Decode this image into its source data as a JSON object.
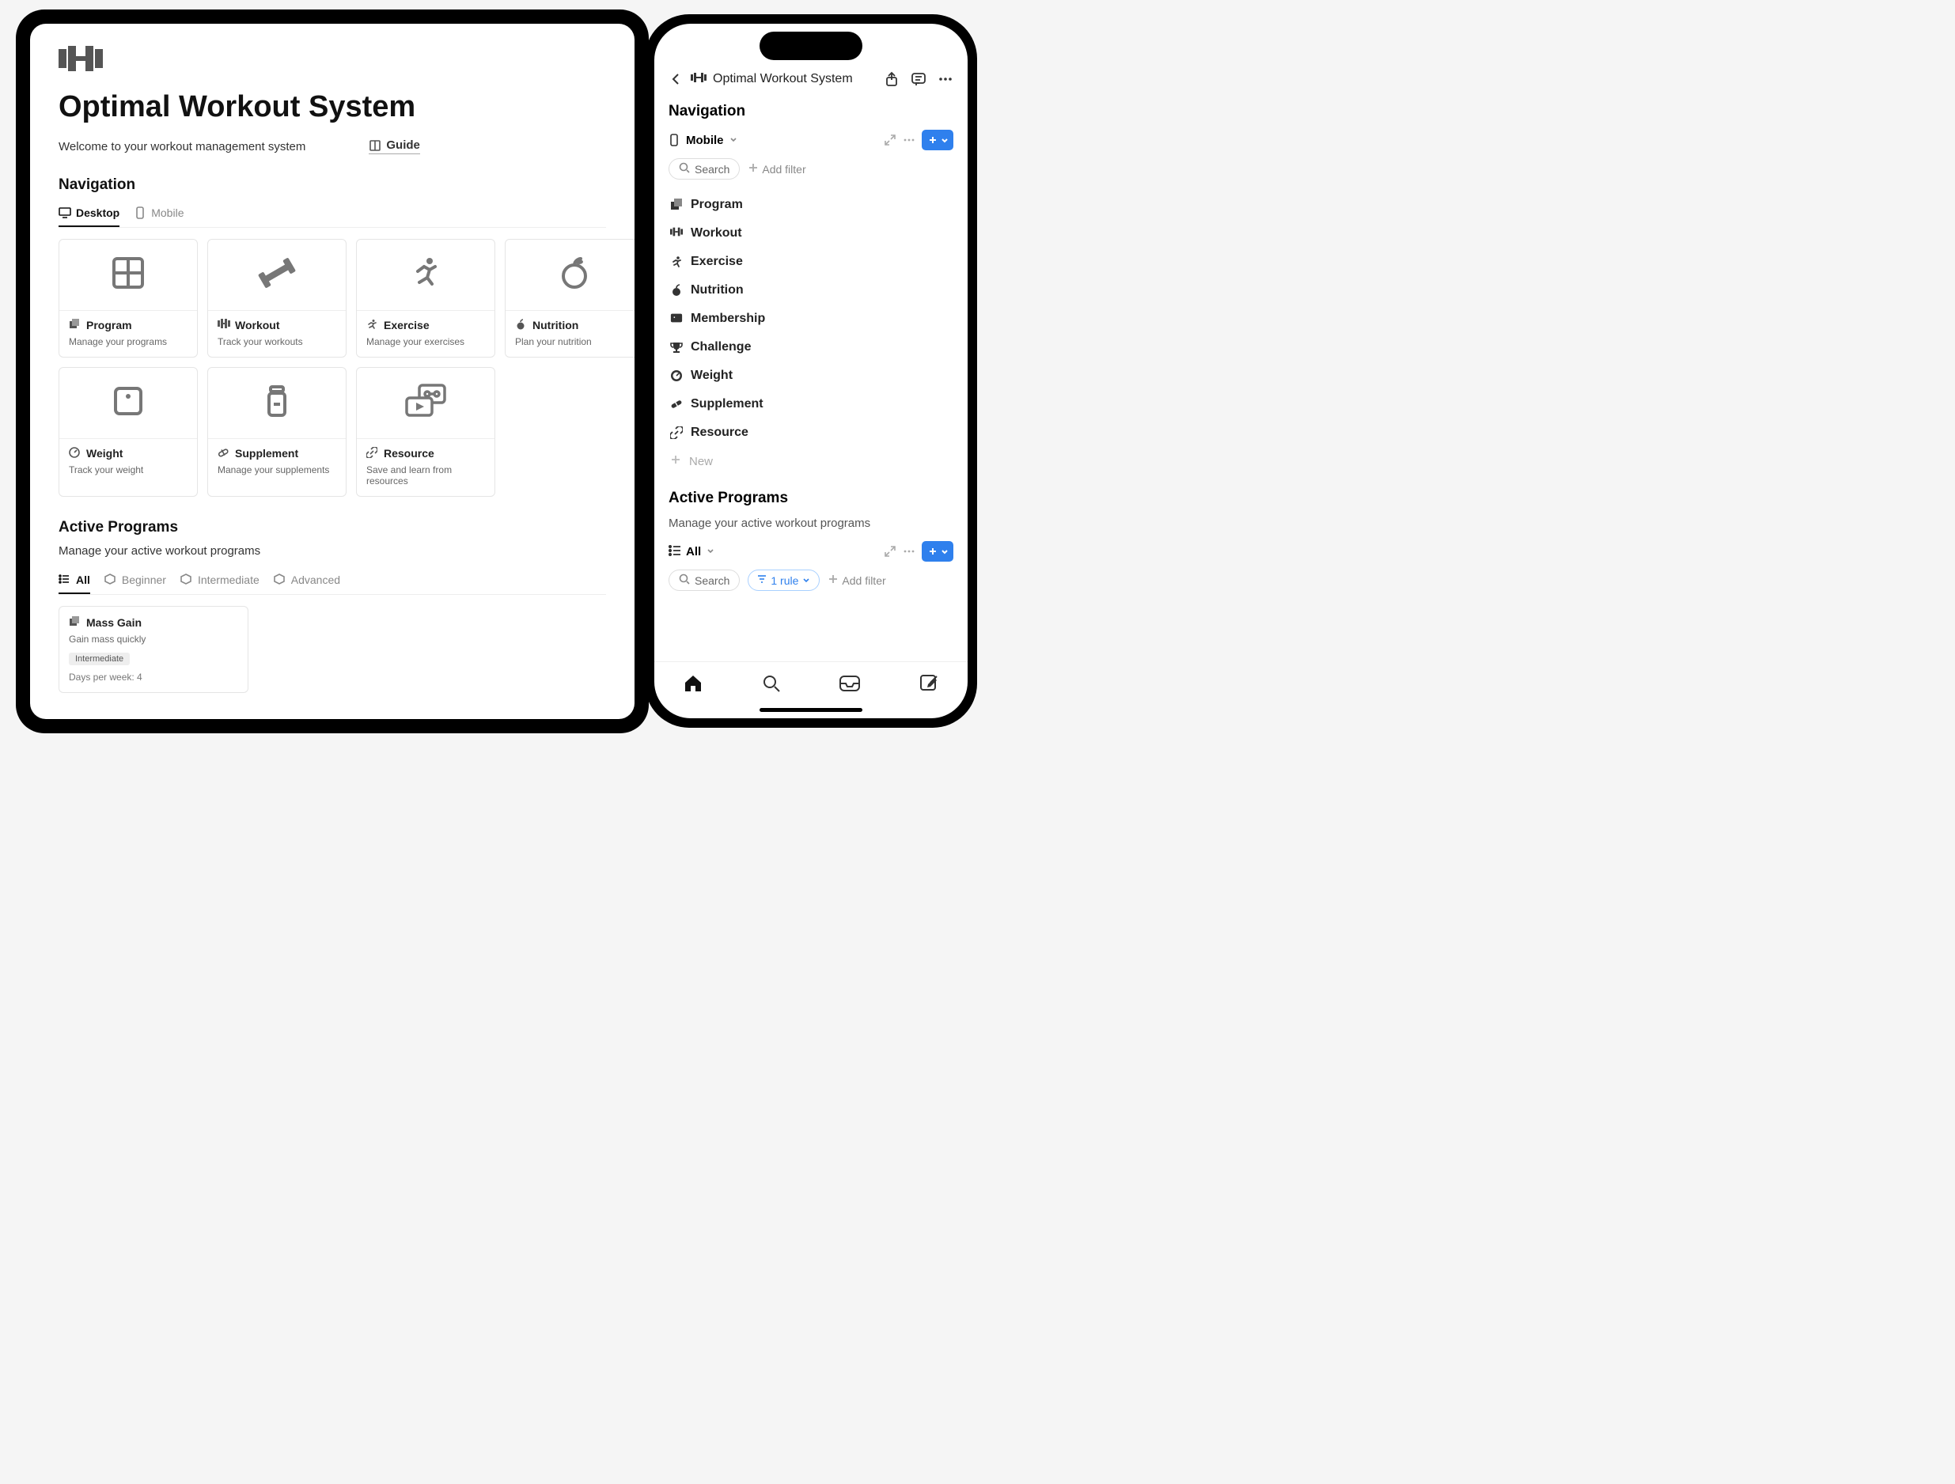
{
  "tablet": {
    "page_title": "Optimal Workout System",
    "welcome_text": "Welcome to your workout management system",
    "guide_label": "Guide",
    "nav_section_title": "Navigation",
    "nav_tabs": [
      {
        "label": "Desktop",
        "icon": "desktop-icon",
        "active": true
      },
      {
        "label": "Mobile",
        "icon": "mobile-icon",
        "active": false
      }
    ],
    "nav_cards": [
      {
        "title": "Program",
        "desc": "Manage your programs",
        "icon": "grid-icon",
        "small_icon": "stack-icon"
      },
      {
        "title": "Workout",
        "desc": "Track your workouts",
        "icon": "dumbbell-icon",
        "small_icon": "barbell-icon"
      },
      {
        "title": "Exercise",
        "desc": "Manage your exercises",
        "icon": "running-icon",
        "small_icon": "running-small-icon"
      },
      {
        "title": "Nutrition",
        "desc": "Plan your nutrition",
        "icon": "apple-icon",
        "small_icon": "apple-small-icon"
      },
      {
        "title": "Weight",
        "desc": "Track your weight",
        "icon": "scale-icon",
        "small_icon": "gauge-icon"
      },
      {
        "title": "Supplement",
        "desc": "Manage your supplements",
        "icon": "bottle-icon",
        "small_icon": "pill-icon"
      },
      {
        "title": "Resource",
        "desc": "Save and learn from resources",
        "icon": "media-icon",
        "small_icon": "link-icon"
      }
    ],
    "ap_section_title": "Active Programs",
    "ap_subtitle": "Manage your active workout programs",
    "ap_filters": [
      {
        "label": "All",
        "icon": "list-icon",
        "active": true
      },
      {
        "label": "Beginner",
        "icon": "hexagon-icon",
        "active": false
      },
      {
        "label": "Intermediate",
        "icon": "hexagon-icon",
        "active": false
      },
      {
        "label": "Advanced",
        "icon": "hexagon-icon",
        "active": false
      }
    ],
    "program_card": {
      "title": "Mass Gain",
      "desc": "Gain mass quickly",
      "tag": "Intermediate",
      "meta": "Days per week: 4"
    }
  },
  "phone": {
    "header_title": "Optimal Workout System",
    "nav_section_title": "Navigation",
    "view_label": "Mobile",
    "search_label": "Search",
    "add_filter_label": "Add filter",
    "nav_items": [
      {
        "label": "Program",
        "icon": "stack-icon"
      },
      {
        "label": "Workout",
        "icon": "barbell-icon"
      },
      {
        "label": "Exercise",
        "icon": "running-small-icon"
      },
      {
        "label": "Nutrition",
        "icon": "apple-small-icon"
      },
      {
        "label": "Membership",
        "icon": "id-card-icon"
      },
      {
        "label": "Challenge",
        "icon": "trophy-icon"
      },
      {
        "label": "Weight",
        "icon": "gauge-icon"
      },
      {
        "label": "Supplement",
        "icon": "pill-icon"
      },
      {
        "label": "Resource",
        "icon": "link-icon"
      }
    ],
    "new_item_label": "New",
    "ap_section_title": "Active Programs",
    "ap_subtitle": "Manage your active workout programs",
    "ap_view_label": "All",
    "rule_label": "1 rule"
  }
}
